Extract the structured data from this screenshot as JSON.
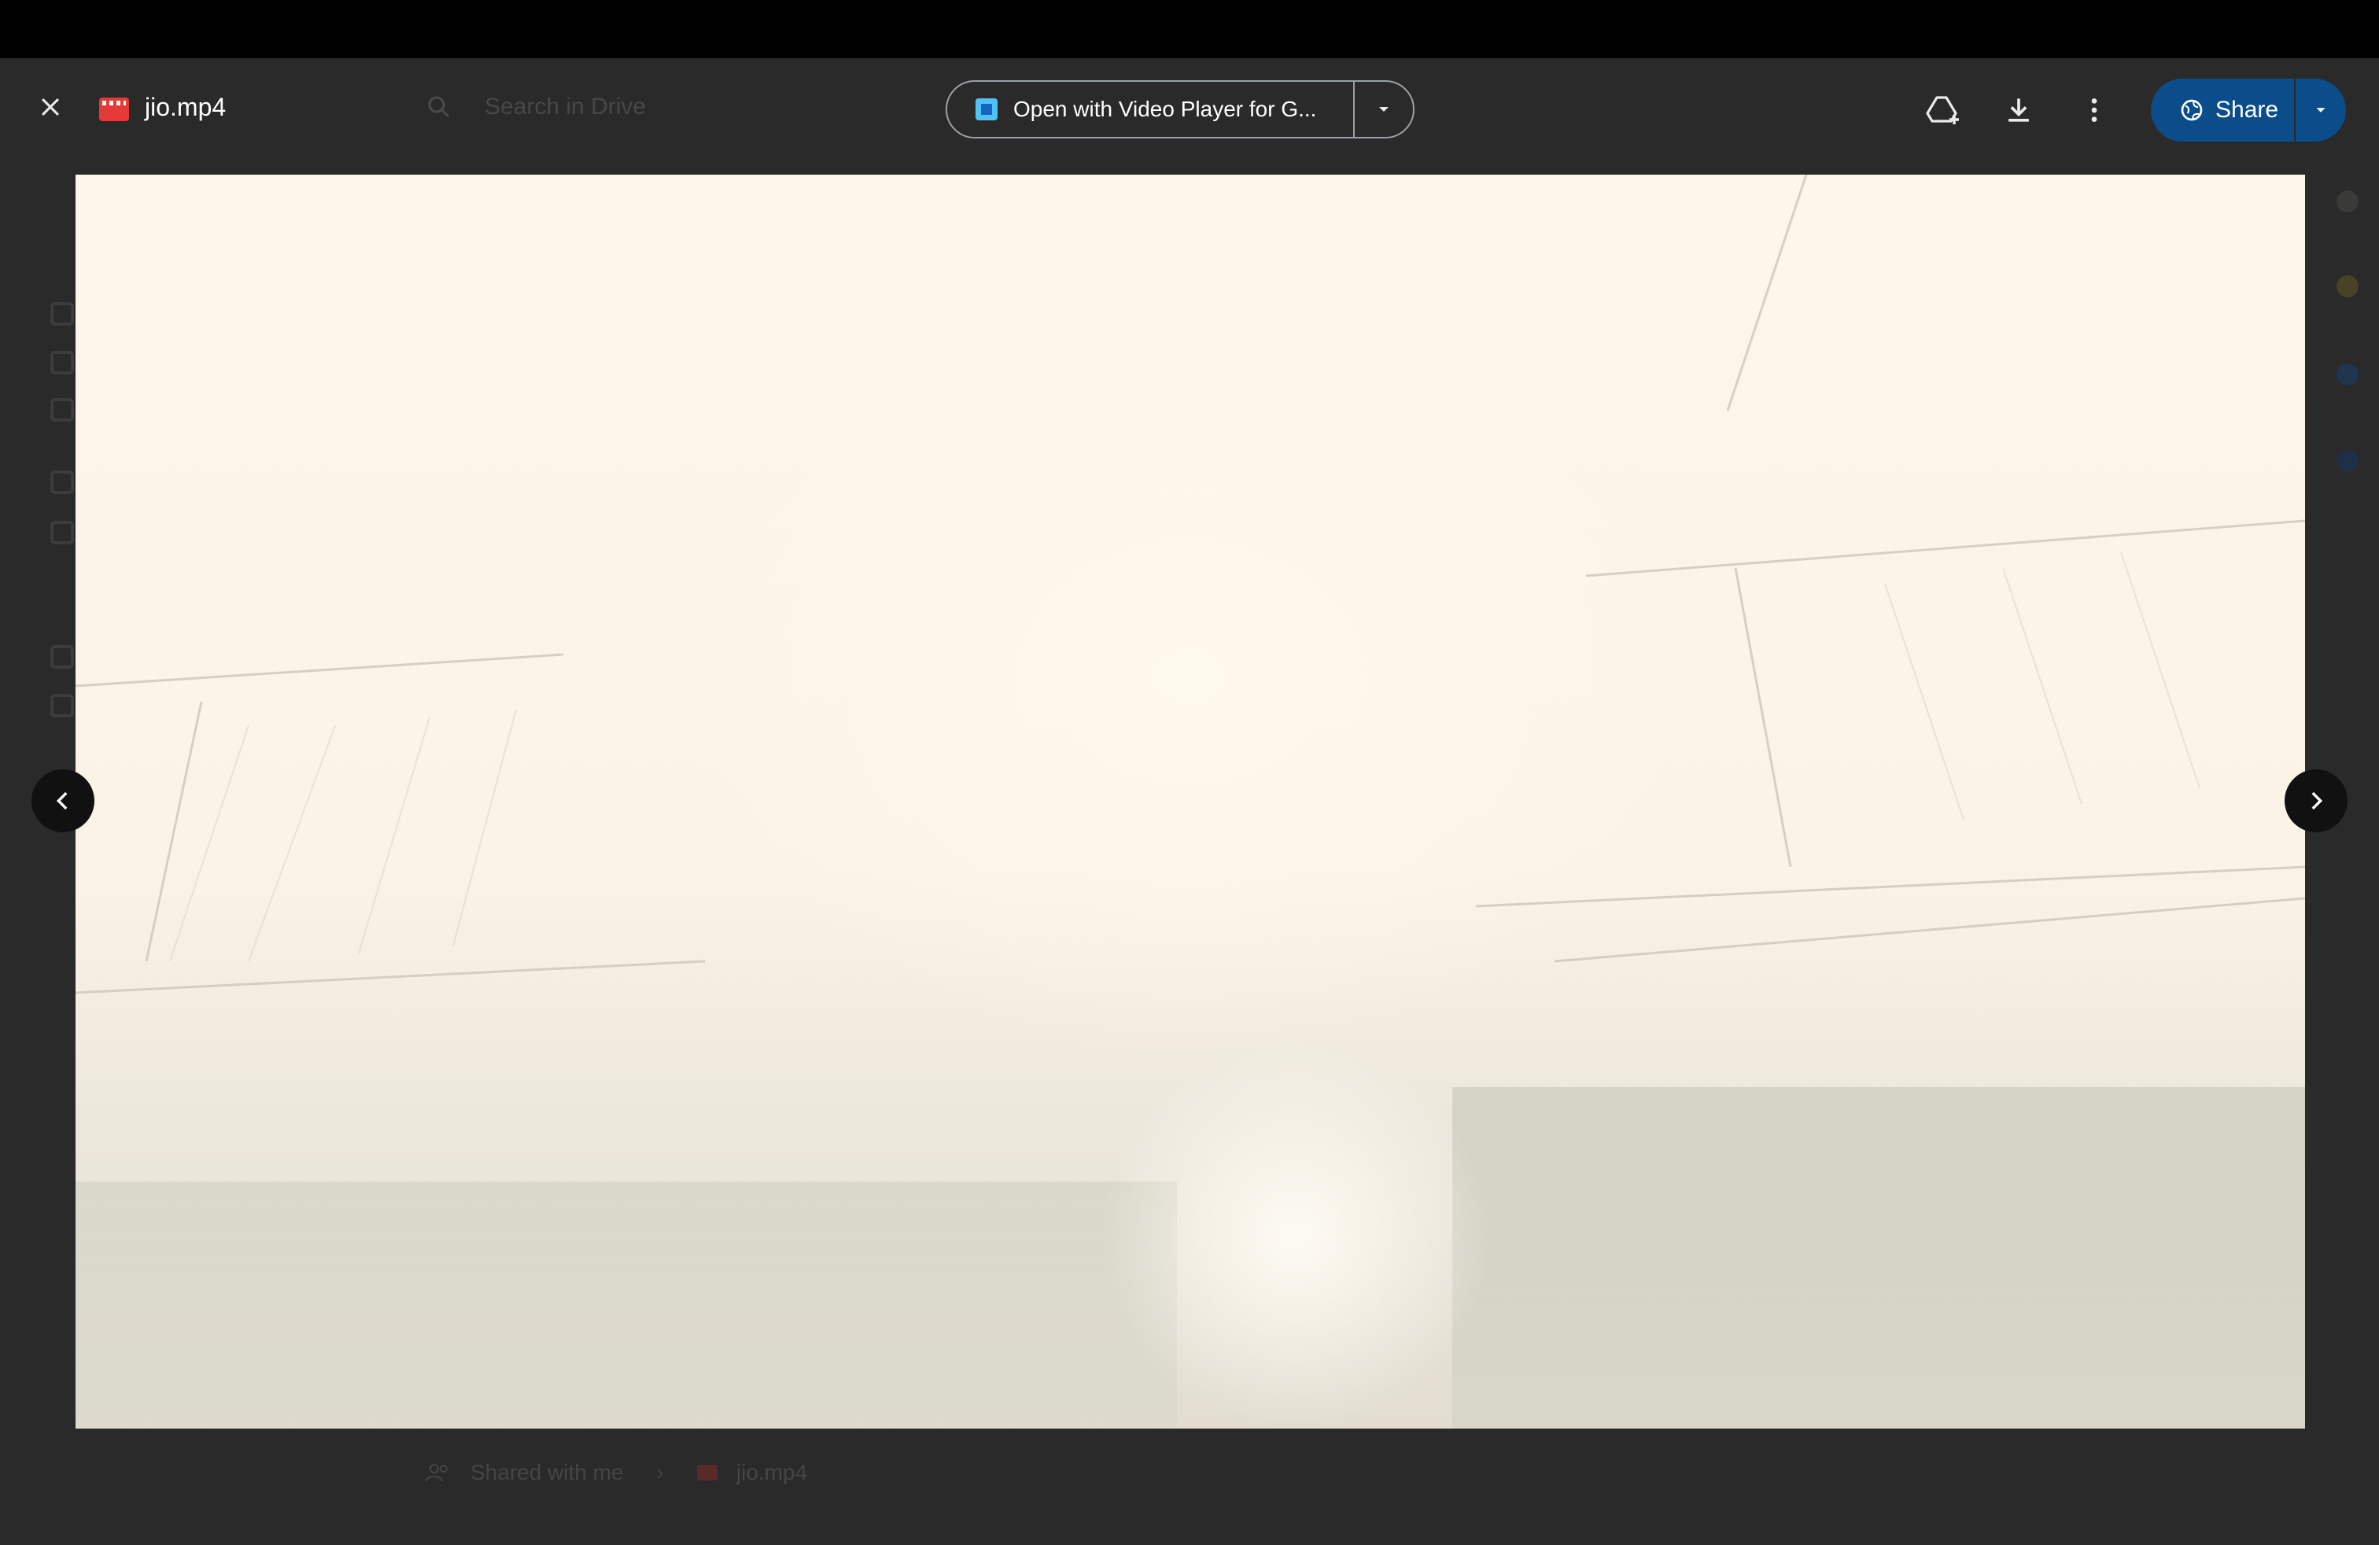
{
  "viewer": {
    "file_name": "jio.mp4",
    "open_with_label": "Open with Video Player for G...",
    "share_label": "Share"
  },
  "background": {
    "search_placeholder": "Search in Drive",
    "breadcrumb": [
      "Shared with me",
      "jio.mp4"
    ]
  },
  "icons": {
    "close": "close-icon",
    "file": "video-file-icon",
    "open_with_app": "video-player-app-icon",
    "open_with_dropdown": "caret-down-icon",
    "add_to_drive": "add-to-drive-icon",
    "download": "download-icon",
    "more": "more-vert-icon",
    "share": "globe-icon",
    "share_dropdown": "caret-down-icon",
    "prev": "chevron-left-icon",
    "next": "chevron-right-icon"
  },
  "colors": {
    "share_button": "#0b4d8a",
    "file_icon": "#e53935",
    "overlay": "#2a2a2a"
  }
}
